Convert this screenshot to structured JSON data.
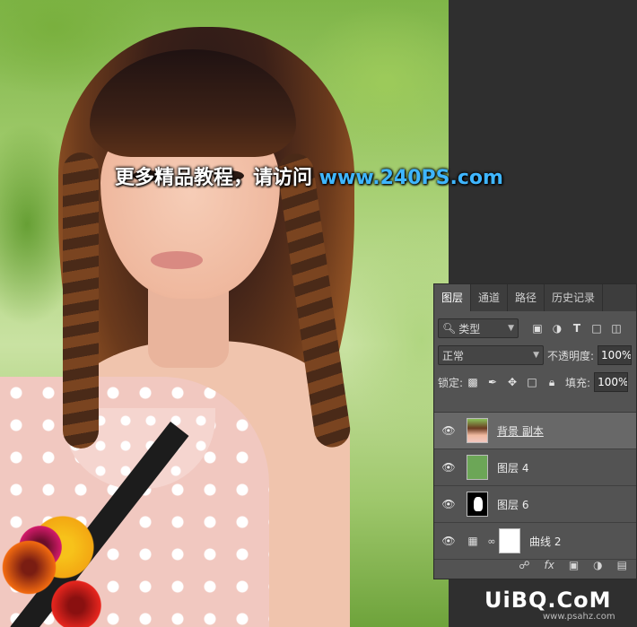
{
  "watermark": {
    "text": "更多精品教程，请访问 ",
    "url": "www.240PS.com"
  },
  "layers_panel": {
    "tabs": [
      {
        "label": "图层",
        "active": true
      },
      {
        "label": "通道",
        "active": false
      },
      {
        "label": "路径",
        "active": false
      },
      {
        "label": "历史记录",
        "active": false
      }
    ],
    "filter": {
      "label": "类型"
    },
    "blend_mode": "正常",
    "opacity_label": "不透明度:",
    "opacity_value": "100%",
    "lock_label": "锁定:",
    "fill_label": "填充:",
    "fill_value": "100%",
    "layers": [
      {
        "name": "背景 副本",
        "thumbnail": "photo",
        "selected": true,
        "visible": true
      },
      {
        "name": "图层 4",
        "thumbnail": "green-fill",
        "selected": false,
        "visible": true
      },
      {
        "name": "图层 6",
        "thumbnail": "mask",
        "selected": false,
        "visible": true
      },
      {
        "name": "曲线 2",
        "thumbnail": "curves-adjustment",
        "selected": false,
        "visible": true
      }
    ]
  },
  "logo": {
    "text": "UiBQ.CoM",
    "sub": "www.psahz.com"
  }
}
